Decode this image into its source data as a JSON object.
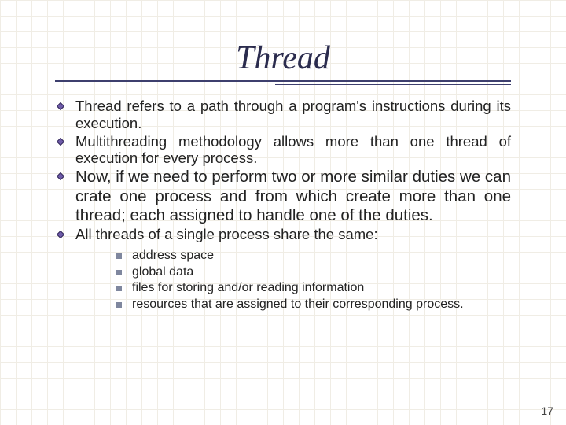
{
  "title": "Thread",
  "bullets": {
    "b0": "Thread refers to a path through a program's instructions during its execution.",
    "b1": "Multithreading methodology allows more than one thread of execution for every process.",
    "b2": "Now, if we need to perform two or more similar duties we can crate one process and from which create more than one thread; each assigned to handle one of the duties.",
    "b3": "All threads of a single process share the same:"
  },
  "sub": {
    "s0": "address space",
    "s1": "global data",
    "s2": "files for storing and/or reading information",
    "s3": "resources that are assigned to their corresponding process."
  },
  "page_number": "17"
}
